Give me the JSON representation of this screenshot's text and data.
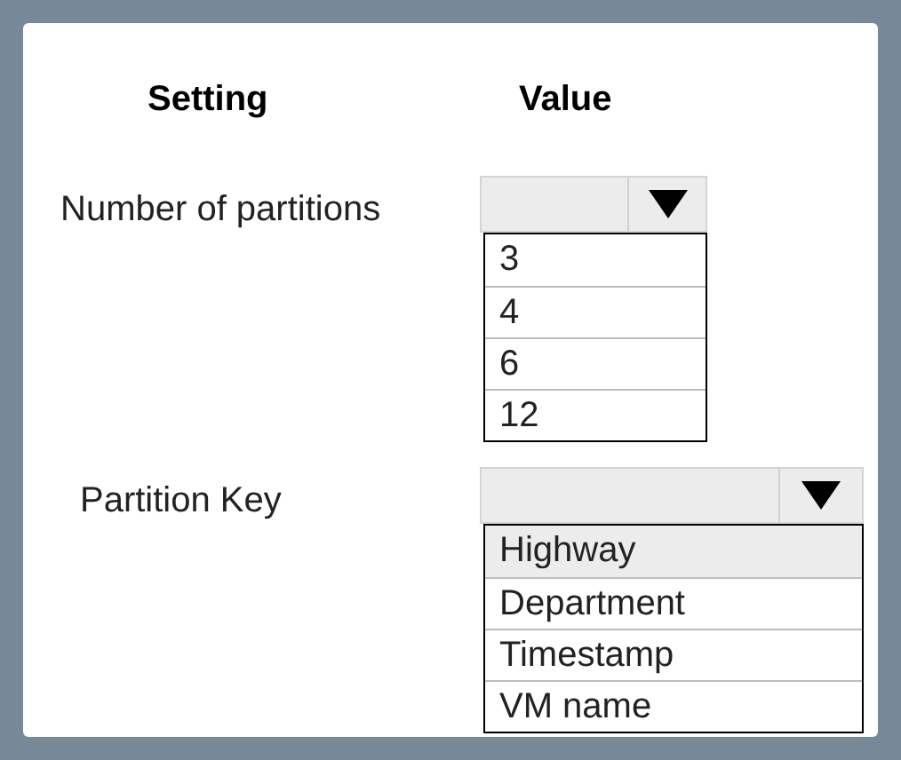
{
  "headers": [
    "Setting",
    "Value"
  ],
  "settings": [
    {
      "label": "Number of partitions",
      "options": [
        {
          "text": "3",
          "selected": false
        },
        {
          "text": "4",
          "selected": false
        },
        {
          "text": "6",
          "selected": false
        },
        {
          "text": "12",
          "selected": false
        }
      ]
    },
    {
      "label": "Partition Key",
      "options": [
        {
          "text": "Highway",
          "selected": true
        },
        {
          "text": "Department",
          "selected": false
        },
        {
          "text": "Timestamp",
          "selected": false
        },
        {
          "text": "VM name",
          "selected": false
        }
      ]
    }
  ]
}
